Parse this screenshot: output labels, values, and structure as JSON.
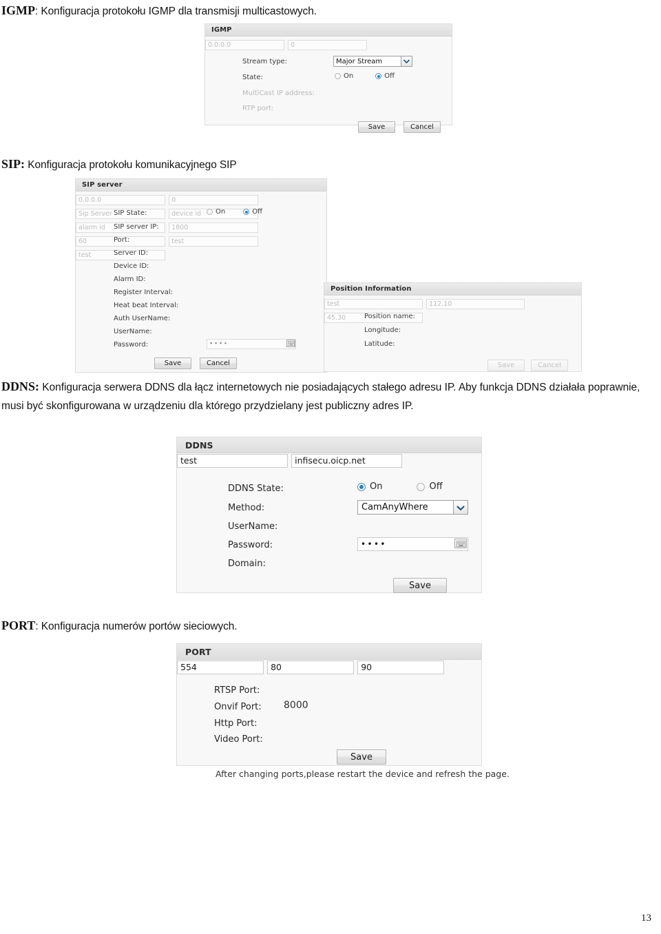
{
  "document": {
    "page_number": "13",
    "sections": [
      {
        "key": "IGMP",
        "heading_bold": "IGMP",
        "heading_rest": ": Konfiguracja protokołu IGMP dla transmisji multicastowych."
      },
      {
        "key": "SIP",
        "heading_bold": "SIP:",
        "heading_rest": " Konfiguracja protokołu komunikacyjnego SIP"
      },
      {
        "key": "DDNS",
        "heading_bold": "DDNS:",
        "heading_rest": " Konfiguracja serwera DDNS dla łącz internetowych nie posiadających stałego adresu IP. Aby funkcja DDNS działała poprawnie, musi być skonfigurowana w urządzeniu dla którego przydzielany jest publiczny adres IP."
      },
      {
        "key": "PORT",
        "heading_bold": "PORT",
        "heading_rest": ": Konfiguracja numerów portów sieciowych."
      }
    ]
  },
  "igmp_panel": {
    "title": "IGMP",
    "labels": {
      "stream_type": "Stream type:",
      "state": "State:",
      "multicast_ip": "MultiCast IP address:",
      "rtp_port": "RTP port:"
    },
    "stream_type_value": "Major Stream",
    "state_on_label": "On",
    "state_off_label": "Off",
    "state_selected": "Off",
    "multicast_ip_value": "0.0.0.0",
    "rtp_port_value": "0",
    "save_label": "Save",
    "cancel_label": "Cancel"
  },
  "sip_panel": {
    "title": "SIP server",
    "labels": {
      "sip_state": "SIP State:",
      "sip_server_ip": "SIP server IP:",
      "port": "Port:",
      "server_id": "Server ID:",
      "device_id": "Device ID:",
      "alarm_id": "Alarm ID:",
      "register_interval": "Register Interval:",
      "heat_beat_interval": "Heat beat Interval:",
      "auth_username": "Auth UserName:",
      "username": "UserName:",
      "password": "Password:"
    },
    "state_on_label": "On",
    "state_off_label": "Off",
    "state_selected": "Off",
    "values": {
      "sip_server_ip": "0.0.0.0",
      "port": "0",
      "server_id": "Sip Server",
      "device_id": "device id",
      "alarm_id": "alarm id",
      "register_interval": "1800",
      "heat_beat_interval": "60",
      "auth_username": "test",
      "username": "test",
      "password": "••••"
    },
    "save_label": "Save",
    "cancel_label": "Cancel"
  },
  "position_panel": {
    "title": "Position Information",
    "labels": {
      "position_name": "Position name:",
      "longitude": "Longitude:",
      "latitude": "Latitude:"
    },
    "values": {
      "position_name": "test",
      "longitude": "112.10",
      "latitude": "45.30"
    },
    "save_label": "Save",
    "cancel_label": "Cancel"
  },
  "ddns_panel": {
    "title": "DDNS",
    "labels": {
      "ddns_state": "DDNS State:",
      "method": "Method:",
      "username": "UserName:",
      "password": "Password:",
      "domain": "Domain:"
    },
    "state_on_label": "On",
    "state_off_label": "Off",
    "state_selected": "On",
    "method_value": "CamAnyWhere",
    "values": {
      "username": "test",
      "password": "••••",
      "domain": "infisecu.oicp.net"
    },
    "save_label": "Save"
  },
  "port_panel": {
    "title": "PORT",
    "labels": {
      "rtsp_port": "RTSP Port:",
      "onvif_port": "Onvif Port:",
      "http_port": "Http Port:",
      "video_port": "Video Port:"
    },
    "values": {
      "rtsp_port": "554",
      "onvif_port": "8000",
      "http_port": "80",
      "video_port": "90"
    },
    "save_label": "Save",
    "note": "After changing ports,please restart the device and refresh the page."
  },
  "colors": {
    "panel_bg": "#f8f8f8",
    "panel_header": "#e6e6e6",
    "radio_accent": "#2a7fbd",
    "text": "#141414",
    "disabled_text": "#bdbdbd"
  }
}
